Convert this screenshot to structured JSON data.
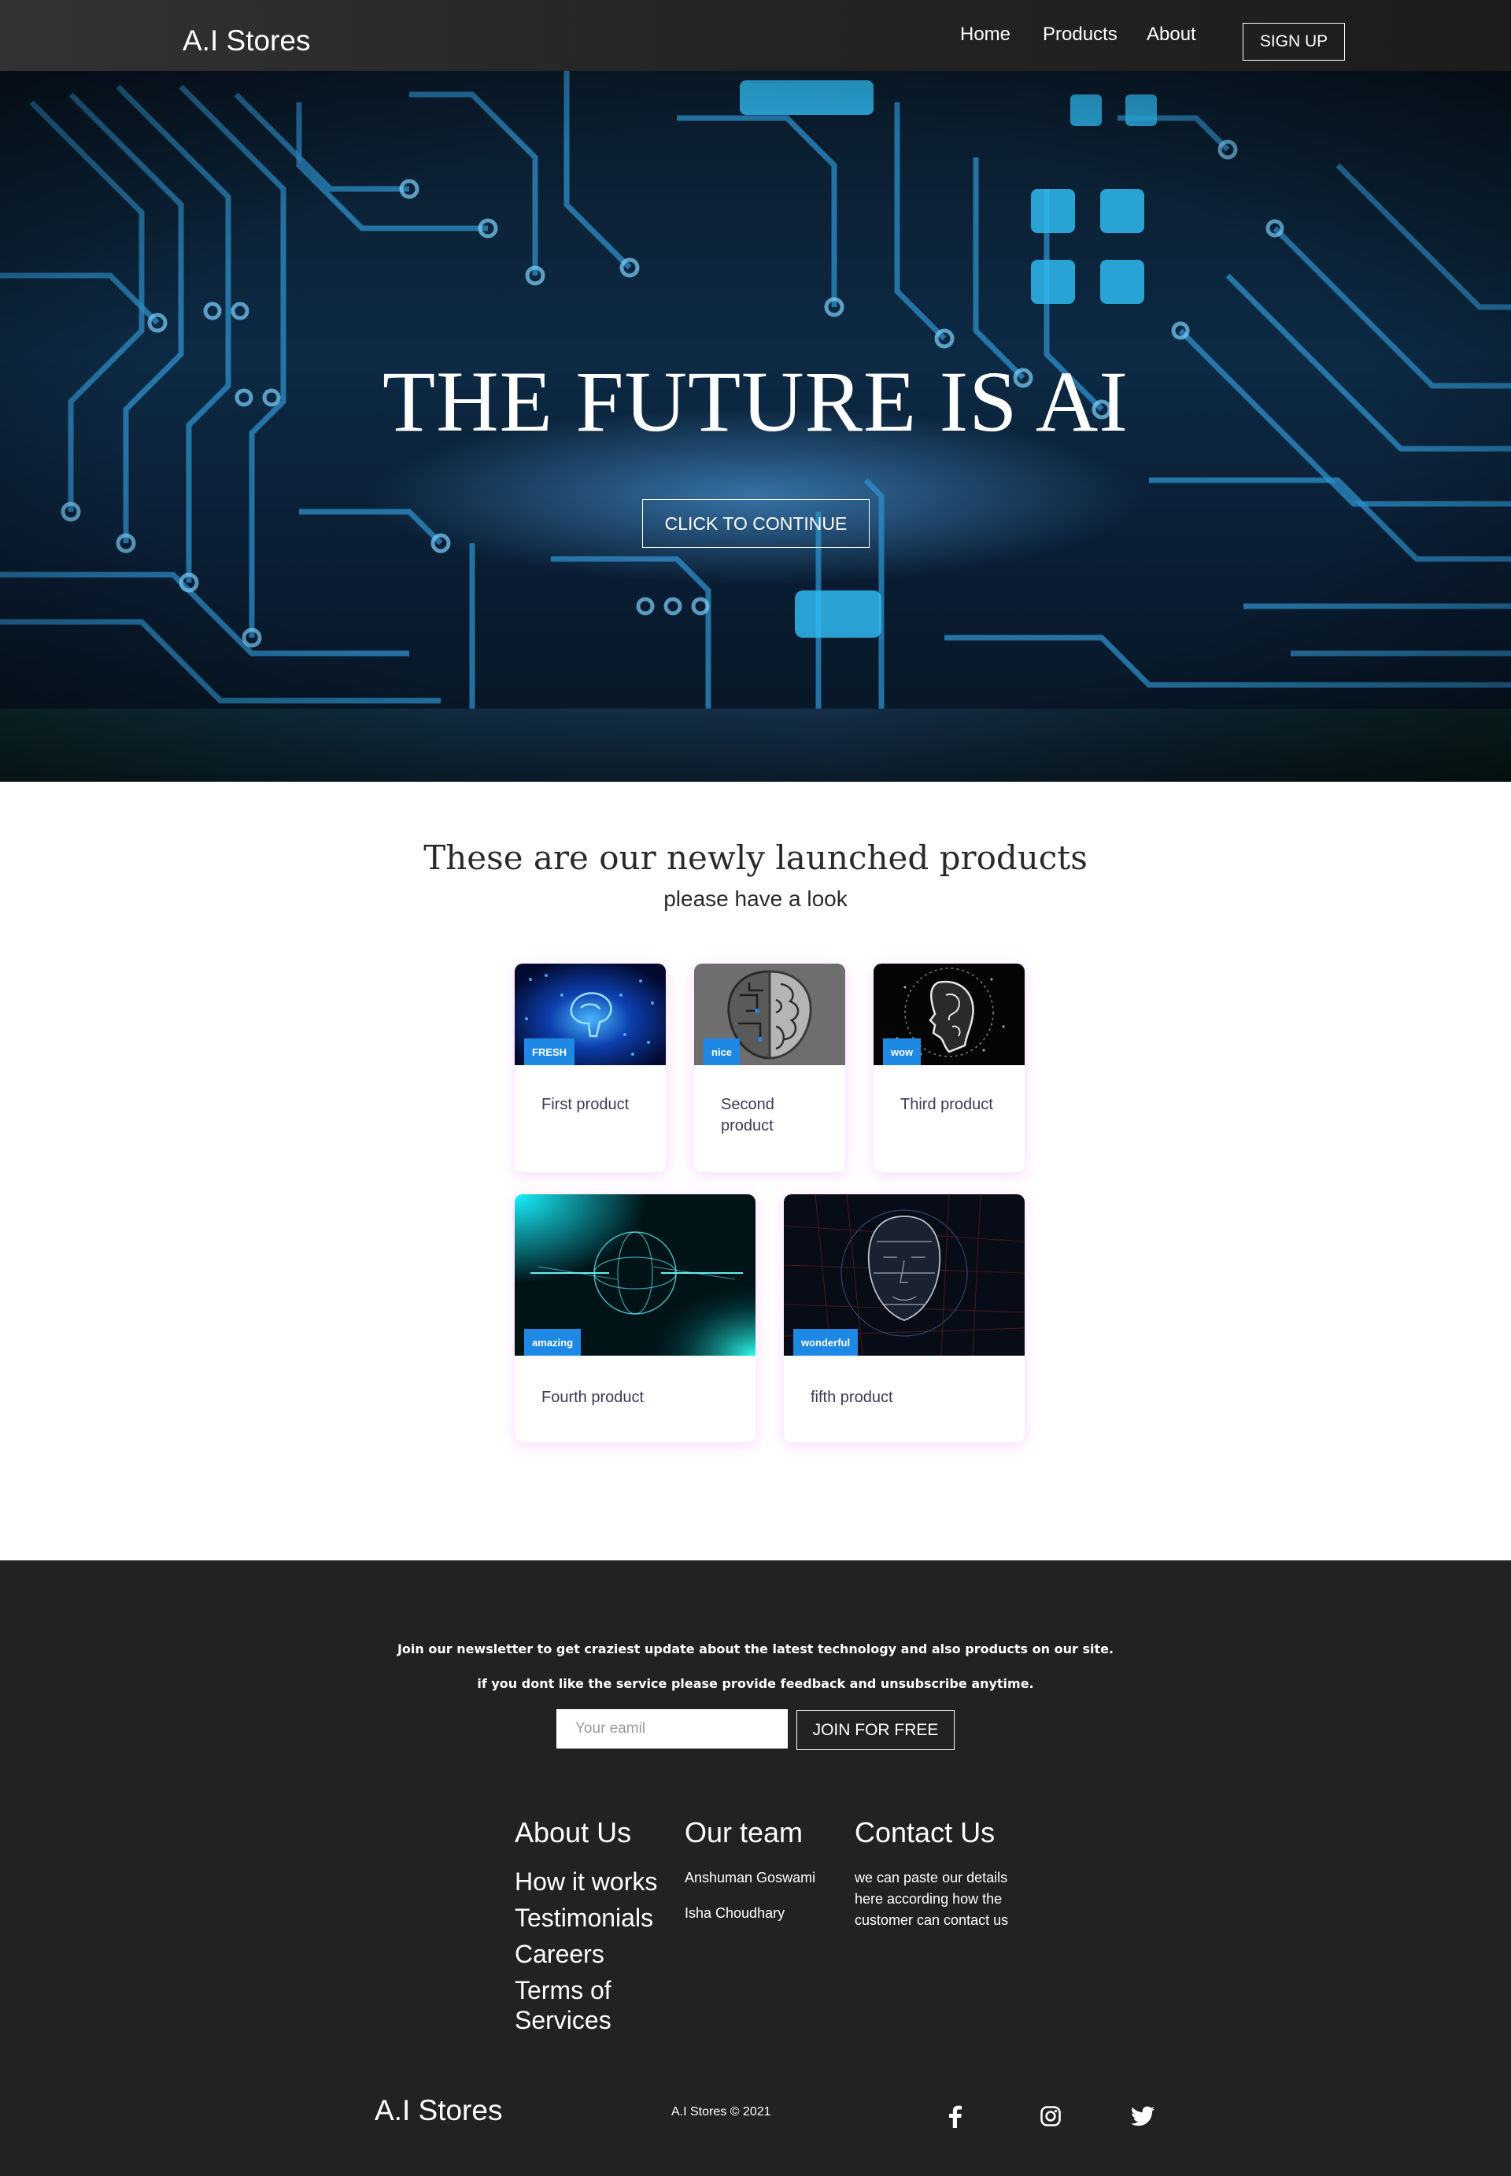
{
  "nav": {
    "brand": "A.I Stores",
    "links": [
      "Home",
      "Products",
      "About"
    ],
    "signup": "SIGN UP"
  },
  "hero": {
    "title": "THE FUTURE IS AI",
    "cta": "CLICK TO CONTINUE"
  },
  "products": {
    "heading": "These are our newly launched products",
    "subheading": "please have a look",
    "items": [
      {
        "tag": "FRESH",
        "name": "First product"
      },
      {
        "tag": "nice",
        "name": "Second product"
      },
      {
        "tag": "wow",
        "name": "Third product"
      },
      {
        "tag": "amazing",
        "name": "Fourth product"
      },
      {
        "tag": "wonderful",
        "name": "fifth product"
      }
    ]
  },
  "footer": {
    "newsletter_line1": "Join our newsletter to get craziest update about the latest technology and also products on our site.",
    "newsletter_line2": "if you dont like the service please provide feedback and unsubscribe anytime.",
    "email_placeholder": "Your eamil",
    "join_label": "JOIN FOR FREE",
    "about": {
      "heading": "About Us",
      "links": [
        "How it works",
        "Testimonials",
        "Careers",
        "Terms of Services"
      ]
    },
    "team": {
      "heading": "Our team",
      "members": [
        "Anshuman Goswami",
        "Isha Choudhary"
      ]
    },
    "contact": {
      "heading": "Contact Us",
      "text": "we can paste our details here according how the customer can contact us"
    },
    "brand": "A.I Stores",
    "copyright": "A.I Stores © 2021",
    "social_icons": [
      "facebook-icon",
      "instagram-icon",
      "twitter-icon"
    ]
  },
  "colors": {
    "nav_bg": "#262626",
    "footer_bg": "#222222",
    "tag_blue": "#1e88e5"
  }
}
